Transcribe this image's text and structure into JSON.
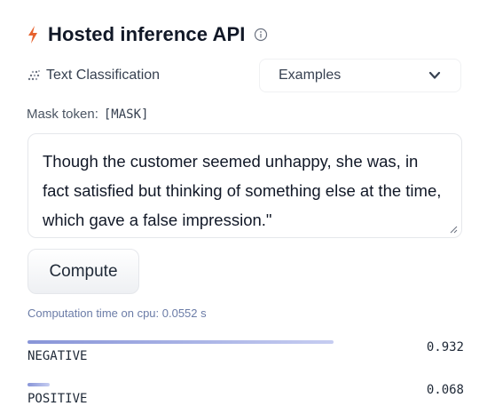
{
  "header": {
    "title": "Hosted inference API",
    "bolt_icon": "bolt-icon",
    "info_icon": "info-circle-icon"
  },
  "task": {
    "label": "Text Classification",
    "icon": "grid-dots-icon"
  },
  "examples_select": {
    "label": "Examples",
    "icon": "chevron-down-icon"
  },
  "mask": {
    "label": "Mask token:",
    "token": "[MASK]"
  },
  "input": {
    "text": "Though the customer seemed unhappy, she was, in fact satisfied but thinking of something else at the time, which gave a false impression.\""
  },
  "compute": {
    "label": "Compute"
  },
  "computation_time": "Computation time on cpu: 0.0552 s",
  "results": [
    {
      "label": "NEGATIVE",
      "score": "0.932",
      "fraction": 0.932
    },
    {
      "label": "POSITIVE",
      "score": "0.068",
      "fraction": 0.068
    }
  ],
  "colors": {
    "accent_bolt": "#e6622e",
    "bar_start": "#8895d8",
    "bar_end": "#c6cdf1",
    "muted_text": "#6b7ca7"
  }
}
